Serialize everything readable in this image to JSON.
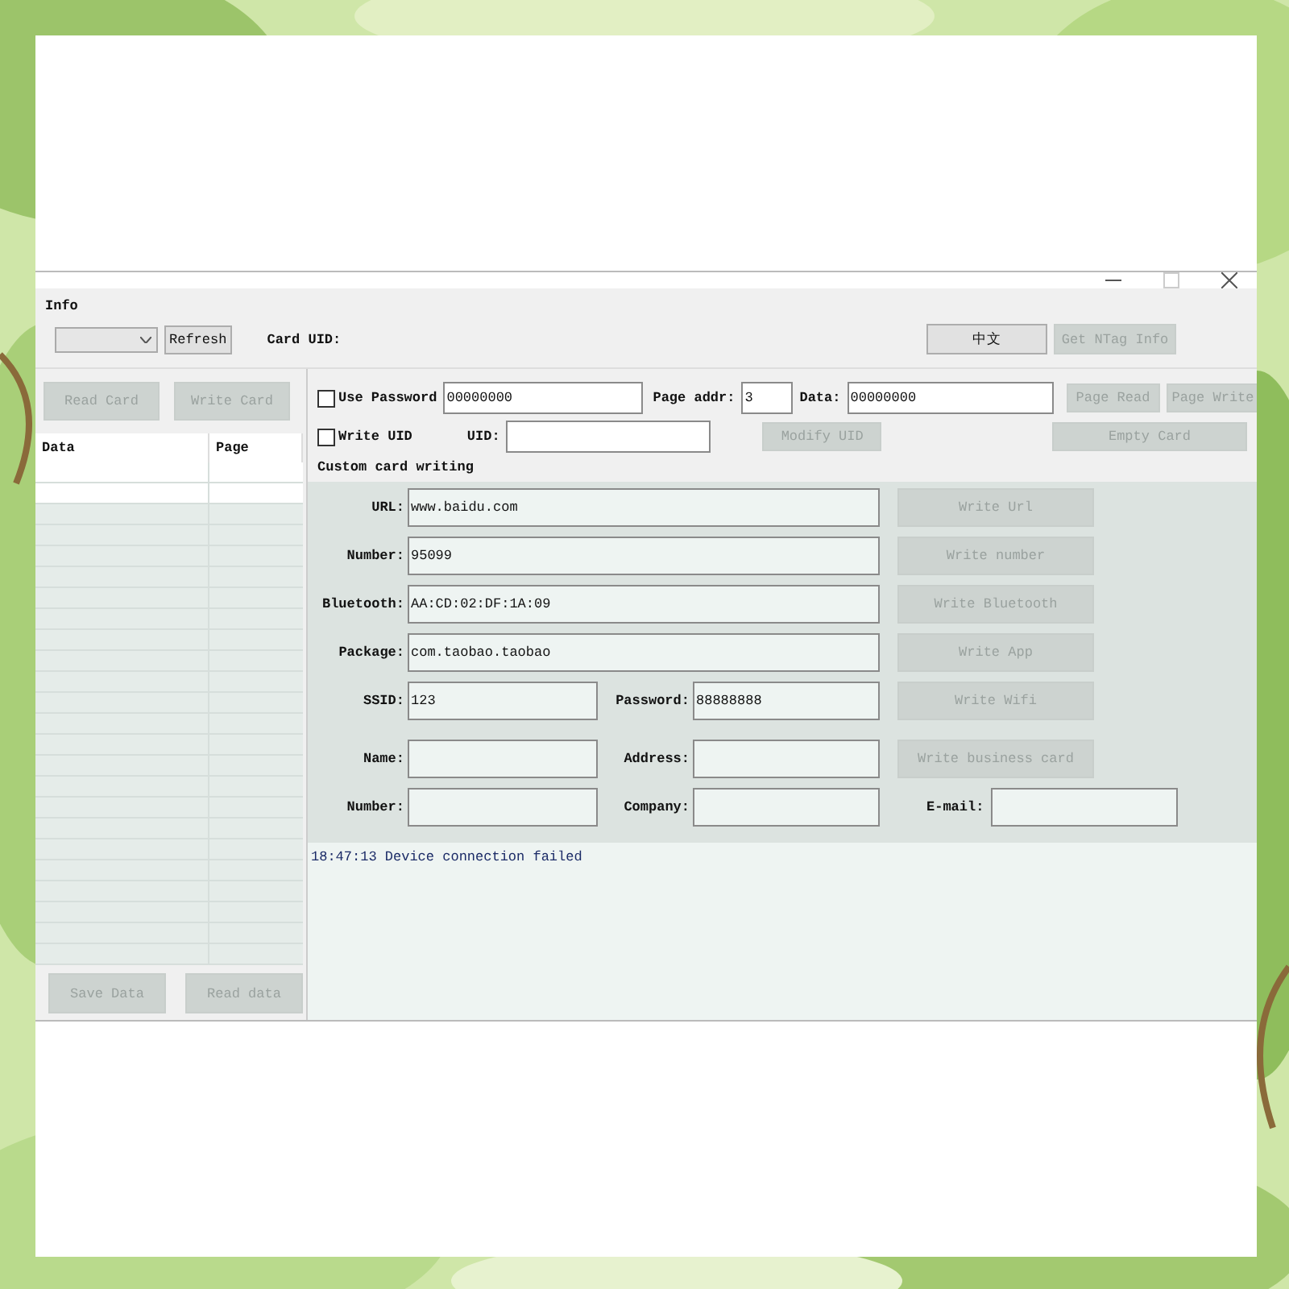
{
  "info": {
    "title": "Info",
    "refresh_button": {
      "label": "Refresh",
      "disabled": false
    },
    "card_uid_label": "Card UID:",
    "language_button": {
      "label": "中文",
      "disabled": false
    },
    "ntag_button": {
      "label": "Get NTag Info",
      "disabled": true
    }
  },
  "card_buttons": [
    {
      "label": "Read Card",
      "disabled": true
    },
    {
      "label": "Write Card",
      "disabled": true
    }
  ],
  "table": {
    "columns": [
      "Data",
      "Page"
    ]
  },
  "data_buttons": [
    {
      "label": "Save Data",
      "disabled": true
    },
    {
      "label": "Read data",
      "disabled": true
    }
  ],
  "password": {
    "label": "Use Password",
    "checked": false,
    "value": "00000000"
  },
  "page_addr": {
    "label": "Page addr:",
    "value": "3"
  },
  "data": {
    "label": "Data:",
    "value": "00000000"
  },
  "page_buttons": [
    {
      "label": "Page Read",
      "disabled": true
    },
    {
      "label": "Page Write",
      "disabled": true
    }
  ],
  "write_uid": {
    "label": "Write UID",
    "checked": false
  },
  "uid": {
    "label": "UID:"
  },
  "modify_uid_button": {
    "label": "Modify UID",
    "disabled": true
  },
  "empty_card_button": {
    "label": "Empty Card",
    "disabled": true
  },
  "custom": {
    "title": "Custom card writing",
    "rows": [
      {
        "kind": "wide",
        "fields": [
          {
            "label": "URL:",
            "value": "www.baidu.com"
          }
        ],
        "button": {
          "label": "Write Url",
          "disabled": true
        }
      },
      {
        "kind": "wide",
        "fields": [
          {
            "label": "Number:",
            "value": "95099"
          }
        ],
        "button": {
          "label": "Write number",
          "disabled": true
        }
      },
      {
        "kind": "wide",
        "fields": [
          {
            "label": "Bluetooth:",
            "value": "AA:CD:02:DF:1A:09"
          }
        ],
        "button": {
          "label": "Write Bluetooth",
          "disabled": true
        }
      },
      {
        "kind": "wide",
        "fields": [
          {
            "label": "Package:",
            "value": "com.taobao.taobao"
          }
        ],
        "button": {
          "label": "Write App",
          "disabled": true
        }
      },
      {
        "kind": "pair",
        "fields": [
          {
            "label": "SSID:",
            "value": "123"
          },
          {
            "label": "Password:",
            "value": "88888888"
          }
        ],
        "button": {
          "label": "Write Wifi",
          "disabled": true
        }
      },
      {
        "kind": "pair",
        "fields": [
          {
            "label": "Name:"
          },
          {
            "label": "Address:"
          }
        ],
        "button": {
          "label": "Write business card",
          "disabled": true
        }
      },
      {
        "kind": "pair",
        "fields": [
          {
            "label": "Number:"
          },
          {
            "label": "Company:"
          }
        ],
        "extra": {
          "label": "E-mail:"
        }
      }
    ]
  },
  "log": [
    "18:47:13 Device connection failed"
  ]
}
